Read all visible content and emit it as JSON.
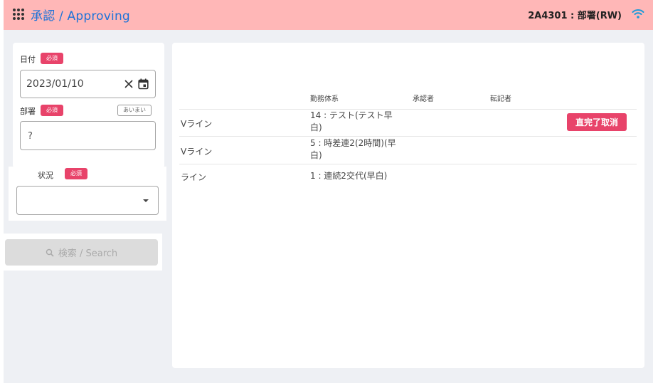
{
  "header": {
    "title": "承認 / Approving",
    "user": "2A4301 : 部署(RW)",
    "menu_icon": "apps-grid-icon",
    "status_icon": "wifi-icon",
    "background_color": "#ffb7b7",
    "title_color": "#1e73d8"
  },
  "form": {
    "date": {
      "label": "日付",
      "required_badge": "必須",
      "value": "2023/01/10"
    },
    "department": {
      "label": "部署",
      "required_badge": "必須",
      "fuzzy_badge": "あいまい",
      "value": "?"
    },
    "status": {
      "label": "状況",
      "required_badge": "必須",
      "value": ""
    },
    "search_button": "検索 / Search",
    "badge_color": "#e8436a"
  },
  "table": {
    "columns": [
      "勤務体系",
      "承認者",
      "転記者"
    ],
    "rows": [
      {
        "line": "Vライン",
        "shift": "14 : テスト(テスト早白)",
        "approver": "",
        "transcriber": "",
        "action": "直完了取消"
      },
      {
        "line": "Vライン",
        "shift": "5 : 時差連2(2時間)(早白)",
        "approver": "",
        "transcriber": "",
        "action": ""
      },
      {
        "line": "ライン",
        "shift": "1 : 連続2交代(早白)",
        "approver": "",
        "transcriber": "",
        "action": ""
      }
    ]
  }
}
